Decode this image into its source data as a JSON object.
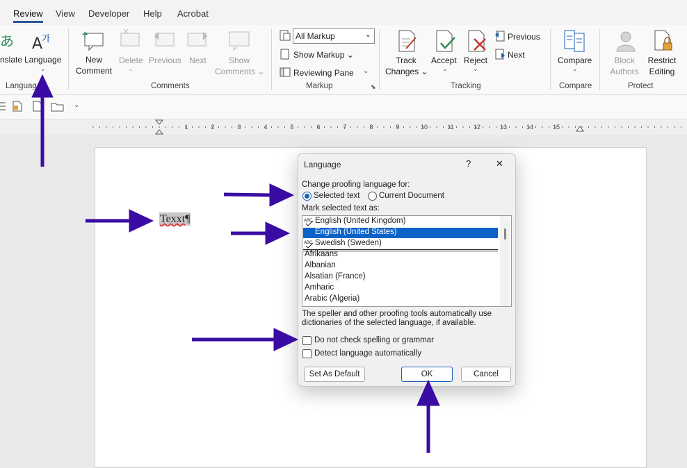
{
  "tabs": [
    "Review",
    "View",
    "Developer",
    "Help",
    "Acrobat"
  ],
  "active_tab": "Review",
  "ribbon": {
    "translate_label": "nslate",
    "language_label": "Language",
    "language_group_label": "Languag",
    "new_comment": [
      "New",
      "Comment"
    ],
    "delete": "Delete",
    "previous": "Previous",
    "next": "Next",
    "show_comments": [
      "Show",
      "Comments"
    ],
    "comments_group": "Comments",
    "markup_dropdown": "All Markup",
    "show_markup": "Show Markup",
    "reviewing_pane": "Reviewing Pane",
    "markup_group": "Markup",
    "track_changes": [
      "Track",
      "Changes"
    ],
    "accept": "Accept",
    "reject": "Reject",
    "tracking_previous": "Previous",
    "tracking_next": "Next",
    "tracking_group": "Tracking",
    "compare": "Compare",
    "compare_group": "Compare",
    "block_authors": [
      "Block",
      "Authors"
    ],
    "restrict_editing": [
      "Restrict",
      "Editing"
    ],
    "protect_group": "Protect"
  },
  "ruler": {
    "numbers": [
      "1",
      "2",
      "3",
      "4",
      "5",
      "6",
      "7",
      "8",
      "9",
      "10",
      "11",
      "12",
      "13",
      "14",
      "15"
    ]
  },
  "document": {
    "text": "Texxt",
    "pilcrow": "¶"
  },
  "dialog": {
    "title": "Language",
    "help": "?",
    "close": "✕",
    "proofing_label": "Change proofing language for:",
    "radio_selected_text": "Selected text",
    "radio_current_document": "Current Document",
    "mark_label": "Mark selected text as:",
    "languages_top": [
      "English (United Kingdom)",
      "English (United States)",
      "Swedish (Sweden)"
    ],
    "languages": [
      "Afrikaans",
      "Albanian",
      "Alsatian (France)",
      "Amharic",
      "Arabic (Algeria)"
    ],
    "selected_language": "English (United States)",
    "note_line1": "The speller and other proofing tools automatically use",
    "note_line2": "dictionaries of the selected language, if available.",
    "chk_no_spell": "Do not check spelling or grammar",
    "chk_detect": "Detect language automatically",
    "btn_default": "Set As Default",
    "btn_ok": "OK",
    "btn_cancel": "Cancel"
  },
  "colors": {
    "accent": "#2b579a",
    "selection": "#0b63c7",
    "annotation_arrow": "#3a0ca3"
  }
}
